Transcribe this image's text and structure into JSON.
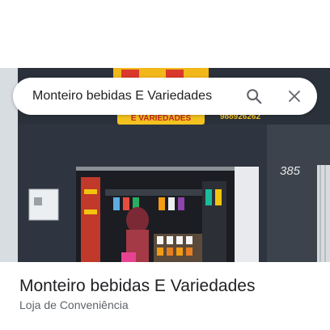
{
  "search": {
    "query": "Monteiro bebidas E Variedades",
    "search_icon": "search-icon",
    "close_icon": "close-icon"
  },
  "place": {
    "name": "Monteiro bebidas E Variedades",
    "category": "Loja de Conveniência"
  },
  "storefront_photo": {
    "sign_text": "E VARIEDADES",
    "phone_text": "988926262",
    "house_number": "385"
  },
  "colors": {
    "accent_icon": "#5f6368",
    "text_primary": "#202124",
    "text_secondary": "#5f6368"
  }
}
